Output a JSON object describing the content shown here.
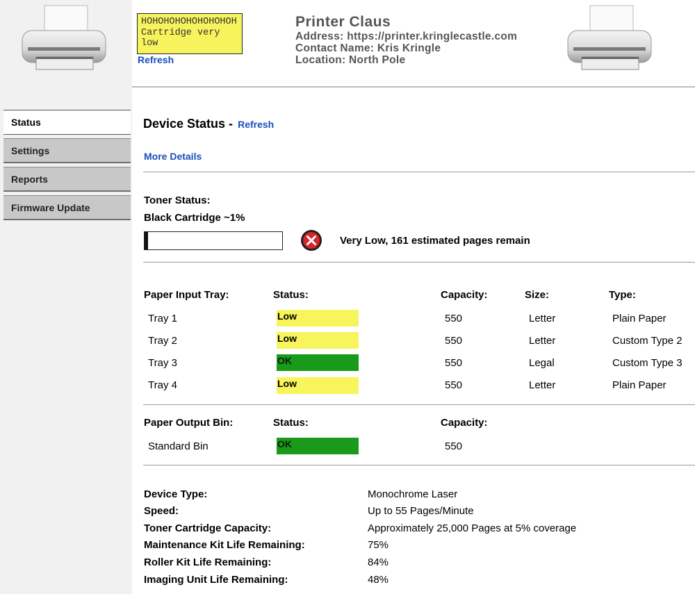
{
  "header": {
    "lcd_message": "HOHOHOHOHOHOHOHOH\nCartridge very\nlow",
    "lcd_refresh": "Refresh",
    "printer_name": "Printer Claus",
    "address": "Address: https://printer.kringlecastle.com",
    "contact": "Contact Name: Kris Kringle",
    "location": "Location: North Pole",
    "icons": [
      "printer-icon",
      "printer-icon"
    ]
  },
  "nav": {
    "items": [
      {
        "label": "Status",
        "active": true
      },
      {
        "label": "Settings",
        "active": false
      },
      {
        "label": "Reports",
        "active": false
      },
      {
        "label": "Firmware Update",
        "active": false
      }
    ]
  },
  "main": {
    "title": "Device Status -",
    "refresh": "Refresh",
    "more_details": "More Details",
    "toner": {
      "heading": "Toner Status:",
      "cartridge": "Black Cartridge ~1%",
      "level_percent": 1,
      "message": "Very Low, 161 estimated pages remain",
      "icon": "error-icon"
    },
    "input_trays": {
      "headers": {
        "tray": "Paper Input Tray:",
        "status": "Status:",
        "capacity": "Capacity:",
        "size": "Size:",
        "type": "Type:"
      },
      "rows": [
        {
          "name": "Tray 1",
          "status": "Low",
          "capacity": "550",
          "size": "Letter",
          "type": "Plain Paper"
        },
        {
          "name": "Tray 2",
          "status": "Low",
          "capacity": "550",
          "size": "Letter",
          "type": "Custom Type 2"
        },
        {
          "name": "Tray 3",
          "status": "OK",
          "capacity": "550",
          "size": "Legal",
          "type": "Custom Type 3"
        },
        {
          "name": "Tray 4",
          "status": "Low",
          "capacity": "550",
          "size": "Letter",
          "type": "Plain Paper"
        }
      ]
    },
    "output_bin": {
      "headers": {
        "bin": "Paper Output Bin:",
        "status": "Status:",
        "capacity": "Capacity:"
      },
      "rows": [
        {
          "name": "Standard Bin",
          "status": "OK",
          "capacity": "550"
        }
      ]
    },
    "device_info": [
      {
        "label": "Device Type:",
        "value": "Monochrome Laser"
      },
      {
        "label": "Speed:",
        "value": "Up to 55 Pages/Minute"
      },
      {
        "label": "Toner Cartridge Capacity:",
        "value": "Approximately 25,000 Pages at 5% coverage"
      },
      {
        "label": "Maintenance Kit Life Remaining:",
        "value": "75%"
      },
      {
        "label": "Roller Kit Life Remaining:",
        "value": "84%"
      },
      {
        "label": "Imaging Unit Life Remaining:",
        "value": "48%"
      }
    ],
    "colors": {
      "low": "#f8f45c",
      "ok": "#1a9a1a",
      "link": "#1a4dbd"
    }
  }
}
